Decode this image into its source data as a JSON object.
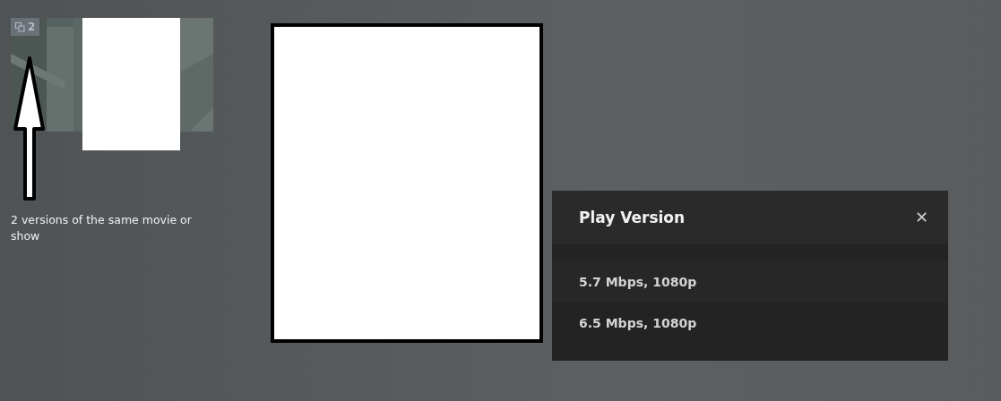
{
  "thumbnail": {
    "kind": "picture",
    "badge": "2"
  },
  "annotation": {
    "caption": "2 versions of the same movie or show"
  },
  "dialog": {
    "title": "Play Version",
    "close": "✕",
    "versions": [
      {
        "label": "5.7 Mbps, 1080p"
      },
      {
        "label": "6.5 Mbps, 1080p"
      }
    ]
  }
}
